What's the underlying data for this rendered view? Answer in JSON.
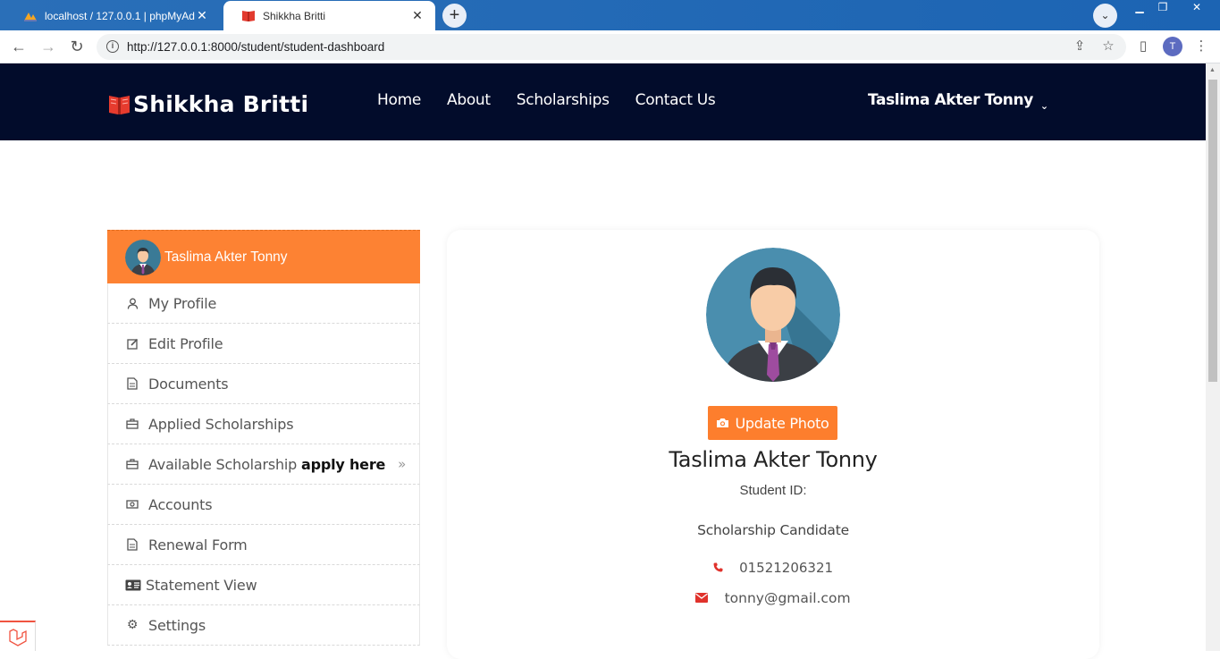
{
  "browser": {
    "tabs": [
      {
        "title": "localhost / 127.0.0.1 | phpMyAdmin",
        "active": false
      },
      {
        "title": "Shikkha Britti",
        "active": true
      }
    ],
    "new_tab": "+",
    "url": "http://127.0.0.1:8000/student/student-dashboard",
    "profile_initial": "T"
  },
  "site": {
    "brand": "Shikkha Britti",
    "nav": [
      "Home",
      "About",
      "Scholarships",
      "Contact Us"
    ],
    "user_name": "Taslima Akter Tonny",
    "colors": {
      "header_bg": "#020c2b",
      "accent": "#fd8233",
      "icon_red": "#e0322c"
    }
  },
  "sidebar": {
    "header_name": "Taslima Akter Tonny",
    "items": [
      {
        "label": "My Profile",
        "icon": "user-icon"
      },
      {
        "label": "Edit Profile",
        "icon": "edit-icon"
      },
      {
        "label": "Documents",
        "icon": "document-icon"
      },
      {
        "label": "Applied Scholarships",
        "icon": "briefcase-icon"
      },
      {
        "label": "Available Scholarship ",
        "emphasis": "apply here",
        "icon": "briefcase-icon"
      },
      {
        "label": "Accounts",
        "icon": "money-icon"
      },
      {
        "label": "Renewal Form",
        "icon": "document-icon"
      },
      {
        "label": "Statement View",
        "icon": "id-card-icon"
      },
      {
        "label": "Settings",
        "icon": "gear-icon"
      }
    ]
  },
  "profile": {
    "update_photo": "Update Photo",
    "name": "Taslima Akter Tonny",
    "student_id_label": "Student ID:",
    "role": "Scholarship Candidate",
    "phone": "01521206321",
    "email": "tonny@gmail.com"
  }
}
